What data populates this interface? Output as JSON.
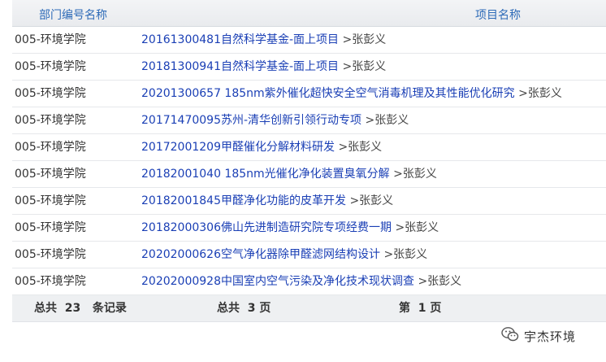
{
  "header": {
    "col_dept": "部门编号名称",
    "col_project": "项目名称"
  },
  "rows": [
    {
      "dept": "005-环境学院",
      "project": "20161300481自然科学基金-面上项目",
      "person": ">张彭义"
    },
    {
      "dept": "005-环境学院",
      "project": "20181300941自然科学基金-面上项目",
      "person": ">张彭义"
    },
    {
      "dept": "005-环境学院",
      "project": "20201300657 185nm紫外催化超快安全空气消毒机理及其性能优化研究",
      "person": ">张彭义"
    },
    {
      "dept": "005-环境学院",
      "project": "20171470095苏州-清华创新引领行动专项",
      "person": ">张彭义"
    },
    {
      "dept": "005-环境学院",
      "project": "20172001209甲醛催化分解材料研发",
      "person": ">张彭义"
    },
    {
      "dept": "005-环境学院",
      "project": "20182001040 185nm光催化净化装置臭氧分解",
      "person": ">张彭义"
    },
    {
      "dept": "005-环境学院",
      "project": "20182001845甲醛净化功能的皮革开发",
      "person": ">张彭义"
    },
    {
      "dept": "005-环境学院",
      "project": "20182000306佛山先进制造研究院专项经费一期",
      "person": ">张彭义"
    },
    {
      "dept": "005-环境学院",
      "project": "20202000626空气净化器除甲醛滤网结构设计",
      "person": ">张彭义"
    },
    {
      "dept": "005-环境学院",
      "project": "20202000928中国室内空气污染及净化技术现状调查",
      "person": ">张彭义"
    }
  ],
  "footer": {
    "total_records": "总共  23   条记录",
    "total_pages": "总共  3 页",
    "current_page": "第  1 页"
  },
  "watermark": {
    "text": "宇杰环境",
    "icon": "wechat-icon"
  }
}
